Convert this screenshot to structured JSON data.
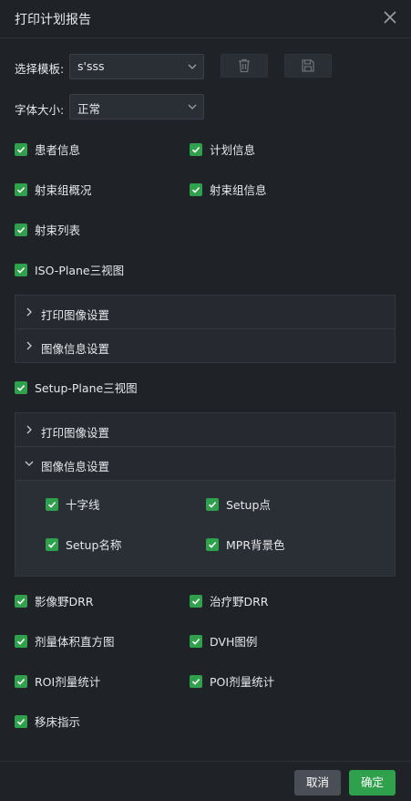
{
  "dialog": {
    "title": "打印计划报告"
  },
  "template": {
    "label": "选择模板:",
    "value": "s'sss"
  },
  "font_size": {
    "label": "字体大小:",
    "value": "正常"
  },
  "checks": {
    "patient_info": {
      "label": "患者信息",
      "checked": true
    },
    "plan_info": {
      "label": "计划信息",
      "checked": true
    },
    "beam_group_overview": {
      "label": "射束组概况",
      "checked": true
    },
    "beam_group_info": {
      "label": "射束组信息",
      "checked": true
    },
    "beam_list": {
      "label": "射束列表",
      "checked": true
    },
    "iso_plane": {
      "label": "ISO-Plane三视图",
      "checked": true
    },
    "setup_plane": {
      "label": "Setup-Plane三视图",
      "checked": true
    },
    "crosshair": {
      "label": "十字线",
      "checked": true
    },
    "setup_point": {
      "label": "Setup点",
      "checked": true
    },
    "setup_name": {
      "label": "Setup名称",
      "checked": true
    },
    "mpr_bg": {
      "label": "MPR背景色",
      "checked": true
    },
    "image_field_drr": {
      "label": "影像野DRR",
      "checked": true
    },
    "treatment_field_drr": {
      "label": "治疗野DRR",
      "checked": true
    },
    "dvh_histogram": {
      "label": "剂量体积直方图",
      "checked": true
    },
    "dvh_legend": {
      "label": "DVH图例",
      "checked": true
    },
    "roi_dose_stats": {
      "label": "ROI剂量统计",
      "checked": true
    },
    "poi_dose_stats": {
      "label": "POI剂量统计",
      "checked": true
    },
    "couch_shift": {
      "label": "移床指示",
      "checked": true
    }
  },
  "iso_panel": {
    "print_image_settings": "打印图像设置",
    "image_info_settings": "图像信息设置"
  },
  "setup_panel": {
    "print_image_settings": "打印图像设置",
    "image_info_settings": "图像信息设置",
    "expanded": "image_info_settings"
  },
  "footer": {
    "cancel_label": "取消",
    "ok_label": "确定"
  },
  "colors": {
    "accent": "#2fa04b",
    "background": "#1f2227",
    "panel": "#262a30"
  }
}
